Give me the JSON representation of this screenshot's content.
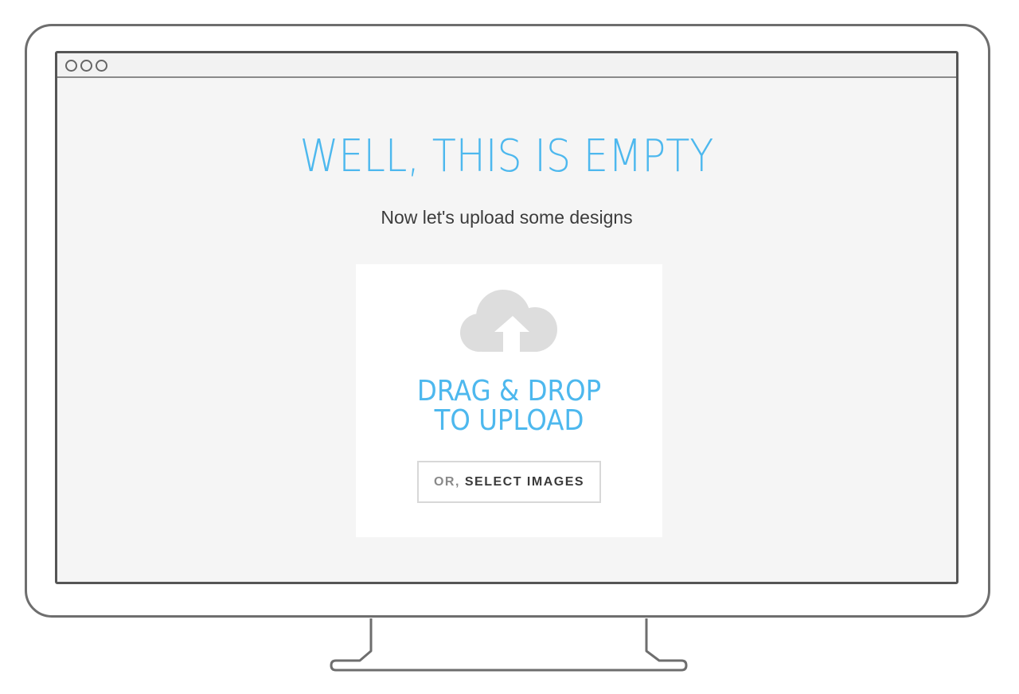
{
  "window": {
    "controls": [
      "window-dot",
      "window-dot",
      "window-dot"
    ]
  },
  "empty_state": {
    "headline": "WELL, THIS IS EMPTY",
    "subtitle": "Now let's upload some designs"
  },
  "dropzone": {
    "icon": "cloud-upload-icon",
    "line1": "DRAG & DROP",
    "line2": "TO UPLOAD",
    "button_prefix": "OR,",
    "button_label": "SELECT IMAGES"
  },
  "colors": {
    "accent": "#4db8ee",
    "text": "#3c3c3c",
    "icon": "#dddddd",
    "screen_bg": "#f5f5f5",
    "frame": "#6e6e6e"
  }
}
